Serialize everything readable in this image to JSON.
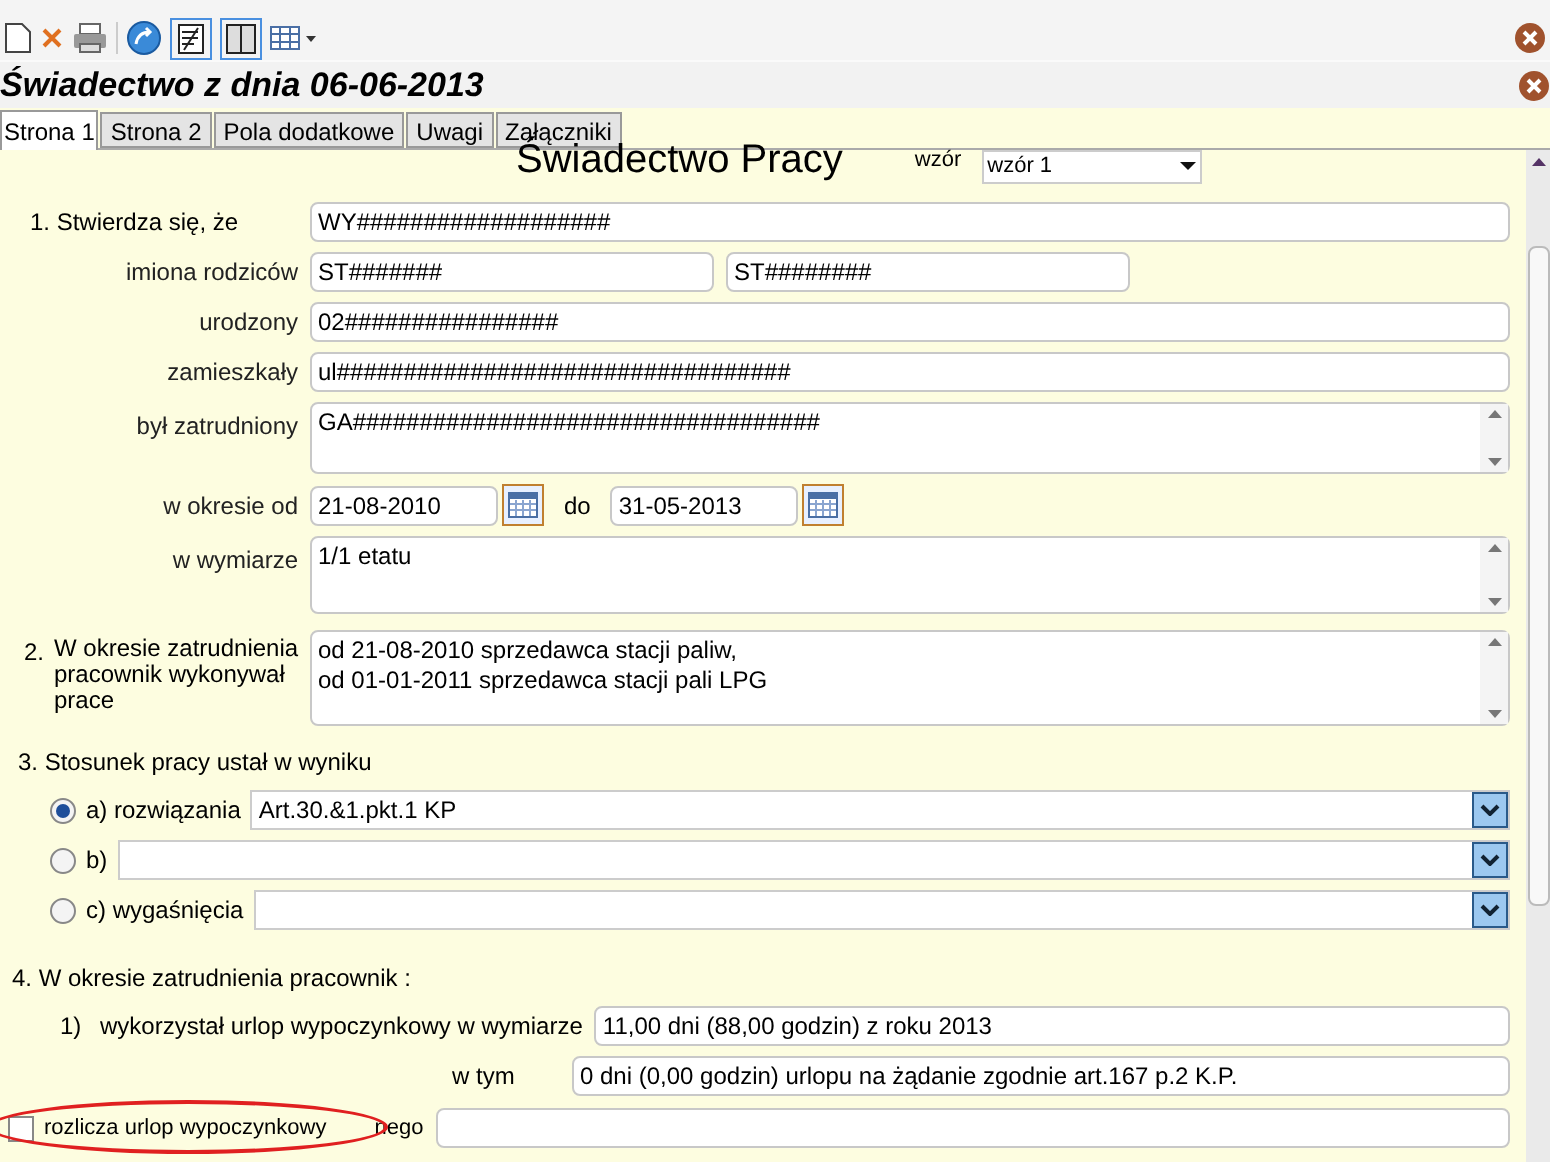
{
  "title": "Świadectwo z dnia 06-06-2013",
  "tabs": [
    {
      "label": "Strona 1",
      "selected": true
    },
    {
      "label": "Strona 2",
      "selected": false
    },
    {
      "label": "Pola dodatkowe",
      "selected": false
    },
    {
      "label": "Uwagi",
      "selected": false
    },
    {
      "label": "Załączniki",
      "selected": false
    }
  ],
  "header": {
    "title": "Świadectwo Pracy",
    "template_label": "wzór",
    "template_value": "wzór 1"
  },
  "section1": {
    "label": "1. Stwierdza się, że",
    "value": "WY###################"
  },
  "parents": {
    "label": "imiona rodziców",
    "values": [
      "ST#######",
      "ST########"
    ]
  },
  "born": {
    "label": "urodzony",
    "value": "02################"
  },
  "address": {
    "label": "zamieszkały",
    "value": "ul##################################"
  },
  "employed": {
    "label": "był zatrudniony",
    "value": "GA###################################"
  },
  "period": {
    "label": "w okresie od",
    "from": "21-08-2010",
    "to_label": "do",
    "to": "31-05-2013"
  },
  "extent": {
    "label": "w wymiarze",
    "value": "1/1 etatu"
  },
  "section2": {
    "number": "2.",
    "label": "W okresie zatrudnienia pracownik wykonywał prace",
    "lines": [
      "od 21-08-2010 sprzedawca stacji paliw,",
      "od 01-01-2011 sprzedawca stacji pali LPG"
    ]
  },
  "section3": {
    "label": "3. Stosunek pracy ustał w  wyniku",
    "options": [
      {
        "label": "a) rozwiązania",
        "value": "Art.30.&1.pkt.1 KP",
        "selected": true
      },
      {
        "label": "b)",
        "selected": false
      },
      {
        "label": "c) wygaśnięcia",
        "selected": false
      }
    ]
  },
  "section4": {
    "label": "4. W okresie zatrudnienia pracownik :",
    "leave": {
      "number": "1)",
      "label": "wykorzystał urlop wypoczynkowy w wymiarze",
      "value": "11,00 dni (88,00 godzin) z roku 2013"
    },
    "including": {
      "label": "w tym",
      "value": "0 dni (0,00 godzin) urlopu na żądanie zgodnie art.167 p.2 K.P."
    }
  },
  "settle": {
    "label": "rozlicza urlop wypoczynkowy",
    "suffix": "nego",
    "checked": false
  }
}
